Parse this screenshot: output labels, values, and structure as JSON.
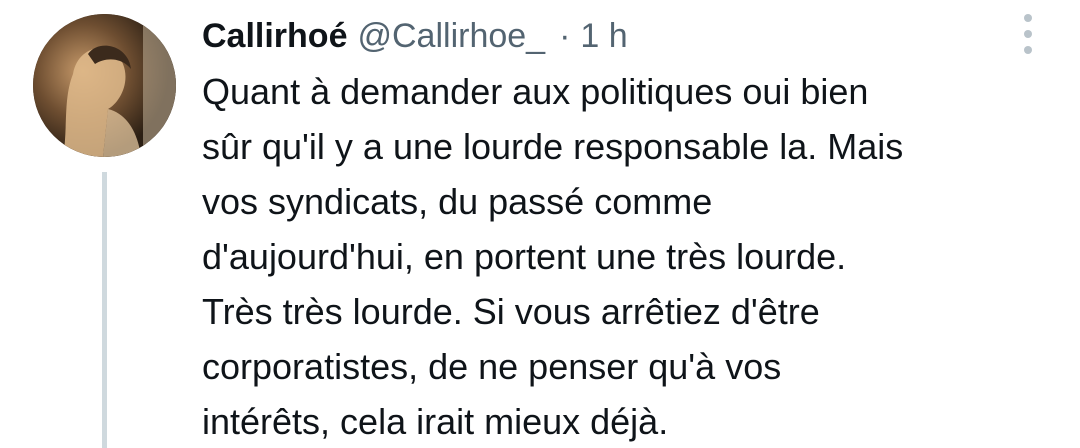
{
  "tweet": {
    "display_name": "Callirhoé",
    "handle": "@Callirhoe_",
    "separator": "·",
    "timestamp": "1 h",
    "text": "Quant à demander aux politiques oui bien\nsûr qu'il y a une lourde responsable la. Mais\nvos syndicats, du passé comme\nd'aujourd'hui, en portent une très lourde.\nTrès très lourde. Si vous arrêtiez d'être\ncorporatistes, de ne penser qu'à vos\nintérêts, cela irait mieux déjà."
  },
  "icons": {
    "avatar": "profile-photo",
    "more": "more-vertical-icon"
  },
  "colors": {
    "text_primary": "#0f1419",
    "text_secondary": "#536471",
    "thread_line": "#cfd9de",
    "more_icon": "#b9c3ca"
  }
}
